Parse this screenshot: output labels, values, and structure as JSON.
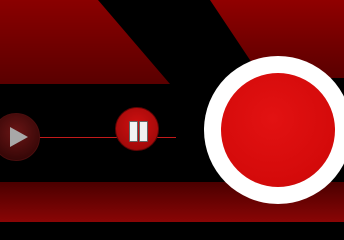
{
  "controls": {
    "play": {
      "icon": "play-icon"
    },
    "pause": {
      "icon": "pause-icon"
    },
    "record": {
      "icon": "record-icon"
    }
  },
  "colors": {
    "background": "#000000",
    "accent_red": "#d40a0a",
    "dark_red": "#5a0000",
    "record_ring": "#ffffff",
    "play_icon": "#a8a8a8"
  }
}
